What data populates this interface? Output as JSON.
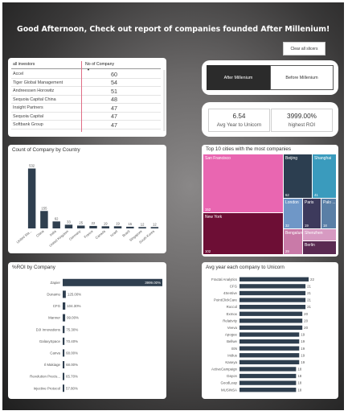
{
  "header": {
    "title": "Good Afternoon, Check out report of companies founded After Millenium!",
    "clear_label": "Clear all slicers"
  },
  "investors": {
    "col1": "all investors",
    "col2": "No of Company",
    "rows": [
      {
        "name": "Accel",
        "value": "60"
      },
      {
        "name": "Tiger Global Management",
        "value": "54"
      },
      {
        "name": "Andreessen Horowitz",
        "value": "51"
      },
      {
        "name": "Sequoia Capital China",
        "value": "48"
      },
      {
        "name": "Insight Partners",
        "value": "47"
      },
      {
        "name": "Sequoia Capital",
        "value": "47"
      },
      {
        "name": "Softbank Group",
        "value": "47"
      }
    ]
  },
  "toggle": {
    "after": "After Millenium",
    "before": "Before Millenium"
  },
  "kpi": {
    "avg_value": "6.54",
    "avg_label": "Avg Year to Unicorn",
    "roi_value": "3999.00%",
    "roi_label": "highest ROI"
  },
  "colors": {
    "bar": "#2f3f4f",
    "background": "#5f5e5e",
    "treemap_pink": "#e966b1",
    "treemap_maroon": "#6d0e35",
    "treemap_navy": "#2c3e50",
    "treemap_teal": "#3a9bbd",
    "treemap_blue": "#6f97c7"
  },
  "chart_data": [
    {
      "type": "bar",
      "title": "Count of Company by Country",
      "categories": [
        "United Sta...",
        "China",
        "India",
        "United Kingdom",
        "Germany",
        "France",
        "Canada",
        "Israel",
        "Brazil",
        "Singapore",
        "South Korea"
      ],
      "values": [
        532,
        155,
        62,
        33,
        25,
        22,
        19,
        19,
        15,
        12,
        12
      ],
      "value_labels": [
        "532",
        "155",
        "62",
        "33",
        "25",
        "22",
        "19",
        "19",
        "15",
        "12",
        "12"
      ],
      "ylim": [
        0,
        600
      ]
    },
    {
      "type": "treemap",
      "title": "Top 10 cities with the most companies",
      "tiles": [
        {
          "name": "San Francisco",
          "value": "152",
          "color": "#e966b1"
        },
        {
          "name": "New York",
          "value": "102",
          "color": "#6d0e35"
        },
        {
          "name": "Beijing",
          "value": "62",
          "color": "#2c3e50"
        },
        {
          "name": "Shanghai",
          "value": "41",
          "color": "#3a9bbd"
        },
        {
          "name": "London",
          "value": "32",
          "color": "#6f97c7"
        },
        {
          "name": "Paris",
          "value": "19",
          "color": "#3d3a5c"
        },
        {
          "name": "Palo ...",
          "value": "18",
          "color": "#5a7fa6"
        },
        {
          "name": "Bengaluru",
          "value": "29",
          "color": "#c97aa8"
        },
        {
          "name": "Shenzhen",
          "value": "",
          "color": "#d79ac2"
        },
        {
          "name": "Berlin",
          "value": "",
          "color": "#5a2a52"
        }
      ]
    },
    {
      "type": "bar",
      "orientation": "horizontal",
      "title": "%ROI by Company",
      "categories": [
        "Zapier",
        "Dunamu",
        "CFG",
        "Manner",
        "DJI Innovations",
        "GalaxySpace",
        "Canva",
        "Il Makiage",
        "Revolution Precis...",
        "Injective Protocol"
      ],
      "values": [
        3999.0,
        125.0,
        104.3,
        99.0,
        75.3,
        70.4,
        68.0,
        68.0,
        65.7,
        57.8
      ],
      "value_labels": [
        "3999.00%",
        "125.00%",
        "104.30%",
        "99.00%",
        "75.30%",
        "70.40%",
        "68.00%",
        "68.00%",
        "65.70%",
        "57.80%"
      ]
    },
    {
      "type": "bar",
      "orientation": "horizontal",
      "title": "Avg year each company to Unicorn",
      "categories": [
        "Fractal Analytics",
        "CFG",
        "4Sentive",
        "PointClickCare",
        "Roccol",
        "Exmox",
        "Relativity",
        "Veeva",
        "Apogee",
        "Bellwe",
        "ISN",
        "Iridius",
        "Kaseya",
        "ActiveCampaign",
        "Dayon",
        "GoodLeap",
        "MUSINSA"
      ],
      "values": [
        22,
        21,
        21,
        21,
        21,
        20,
        20,
        20,
        19,
        19,
        19,
        19,
        19,
        18,
        18,
        18,
        18
      ],
      "value_labels": [
        "22",
        "21",
        "21",
        "21",
        "21",
        "20",
        "20",
        "20",
        "19",
        "19",
        "19",
        "19",
        "19",
        "18",
        "18",
        "18",
        "18"
      ]
    }
  ]
}
